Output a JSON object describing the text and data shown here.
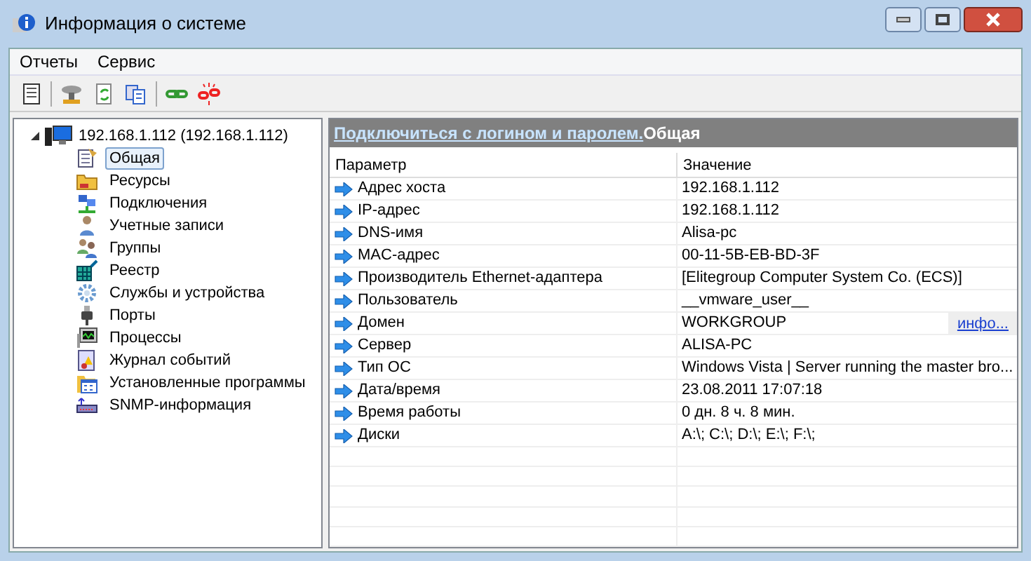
{
  "window": {
    "title": "Информация о системе"
  },
  "menu": [
    "Отчеты",
    "Сервис"
  ],
  "tree": {
    "label": "192.168.1.112 (192.168.1.112)",
    "expanded": true,
    "children": [
      {
        "label": "Общая",
        "selected": true
      },
      {
        "label": "Ресурсы",
        "selected": false
      },
      {
        "label": "Подключения",
        "selected": false
      },
      {
        "label": "Учетные записи",
        "selected": false
      },
      {
        "label": "Группы",
        "selected": false
      },
      {
        "label": "Реестр",
        "selected": false
      },
      {
        "label": "Службы и устройства",
        "selected": false
      },
      {
        "label": "Порты",
        "selected": false
      },
      {
        "label": "Процессы",
        "selected": false
      },
      {
        "label": "Журнал событий",
        "selected": false
      },
      {
        "label": "Установленные программы",
        "selected": false
      },
      {
        "label": "SNMP-информация",
        "selected": false
      }
    ]
  },
  "header": {
    "link": "Подключиться с логином и паролем.",
    "title": "Общая"
  },
  "table": {
    "columns": [
      "Параметр",
      "Значение"
    ],
    "rows": [
      {
        "param": "Адрес хоста",
        "value": "192.168.1.112"
      },
      {
        "param": "IP-адрес",
        "value": "192.168.1.112"
      },
      {
        "param": "DNS-имя",
        "value": "Alisa-pc"
      },
      {
        "param": "MAC-адрес",
        "value": "00-11-5B-EB-BD-3F"
      },
      {
        "param": "Производитель Ethernet-адаптера",
        "value": "[Elitegroup Computer System Co. (ECS)]"
      },
      {
        "param": "Пользователь",
        "value": "__vmware_user__"
      },
      {
        "param": "Домен",
        "value": "WORKGROUP",
        "link": "инфо..."
      },
      {
        "param": "Сервер",
        "value": "ALISA-PC"
      },
      {
        "param": "Тип ОС",
        "value": "Windows Vista | Server running the master bro..."
      },
      {
        "param": "Дата/время",
        "value": "23.08.2011  17:07:18"
      },
      {
        "param": "Время работы",
        "value": "0 дн. 8 ч. 8 мин."
      },
      {
        "param": "Диски",
        "value": "A:\\; C:\\; D:\\; E:\\; F:\\;"
      }
    ]
  }
}
